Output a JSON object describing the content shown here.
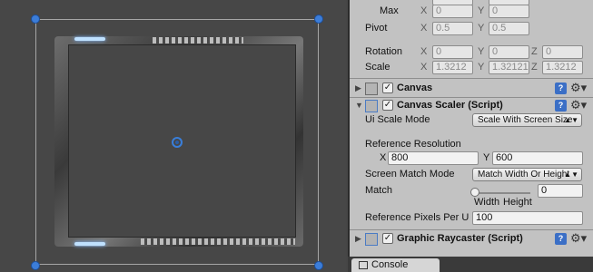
{
  "rect_transform": {
    "max_label": "Max",
    "max_x": "0",
    "max_y": "0",
    "pivot_label": "Pivot",
    "pivot_x": "0.5",
    "pivot_y": "0.5",
    "rotation_label": "Rotation",
    "rotation_x": "0",
    "rotation_y": "0",
    "rotation_z": "0",
    "scale_label": "Scale",
    "scale_x": "1.3212",
    "scale_y": "1.32121",
    "scale_z": "1.3212",
    "axis_x": "X",
    "axis_y": "Y",
    "axis_z": "Z"
  },
  "canvas": {
    "title": "Canvas",
    "enabled": true
  },
  "canvas_scaler": {
    "title": "Canvas Scaler (Script)",
    "ui_scale_mode_label": "Ui Scale Mode",
    "ui_scale_mode_value": "Scale With Screen Size",
    "reference_resolution_label": "Reference Resolution",
    "ref_x_label": "X",
    "ref_x": "800",
    "ref_y_label": "Y",
    "ref_y": "600",
    "screen_match_mode_label": "Screen Match Mode",
    "screen_match_mode_value": "Match Width Or Height",
    "match_label": "Match",
    "match_value": "0",
    "match_slider_fraction": 0,
    "width_label": "Width",
    "height_label": "Height",
    "ref_pixels_label": "Reference Pixels Per U",
    "ref_pixels_value": "100"
  },
  "graphic_raycaster": {
    "title": "Graphic Raycaster (Script)"
  },
  "console_tab": {
    "label": "Console"
  },
  "colors": {
    "handle": "#3c7dd8",
    "inspector_bg": "#c2c2c2",
    "scene_bg": "#474747"
  }
}
